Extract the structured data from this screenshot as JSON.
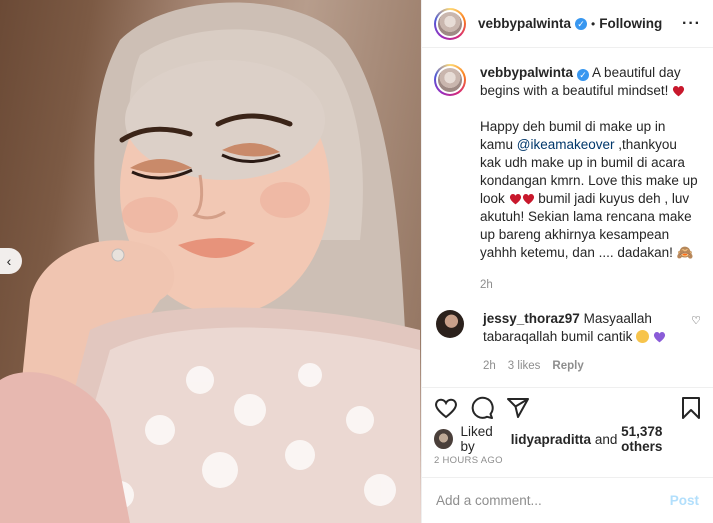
{
  "post": {
    "username": "vebbypalwinta",
    "dot": "•",
    "follow_status": "Following",
    "more_label": "···"
  },
  "caption": {
    "username": "vebbypalwinta",
    "line1": "A beautiful day begins with a beautiful mindset!",
    "p2_a": "Happy deh bumil di make up in kamu",
    "mention": "@ikeamakeover",
    "p2_b": ",thankyou kak udh make up in bumil di acara kondangan kmrn. Love this make up look",
    "p2_c": "bumil jadi kuyus deh , luv akutuh! Sekian lama rencana make up bareng akhirnya kesampean yahhh ketemu, dan .... dadakan!",
    "emoji_monkey": "🙈",
    "time": "2h"
  },
  "comment": {
    "username": "jessy_thoraz97",
    "text": "Masyaallah tabaraqallah bumil cantik",
    "time": "2h",
    "likes": "3 likes",
    "reply": "Reply",
    "like_icon": "♡"
  },
  "likes": {
    "prefix": "Liked by",
    "user": "lidyapraditta",
    "and": "and",
    "count": "51,378 others"
  },
  "timestamp": "2 HOURS AGO",
  "composer": {
    "placeholder": "Add a comment...",
    "post_label": "Post"
  },
  "photo": {
    "nav_prev": "‹"
  },
  "colors": {
    "verified": "#3897f0",
    "post_button": "#b2dffc",
    "muted": "#8e8e8e",
    "mention": "#00376b"
  },
  "icons": [
    "verified-badge-icon",
    "heart-icon",
    "comment-icon",
    "share-icon",
    "bookmark-icon",
    "chevron-left-icon"
  ]
}
